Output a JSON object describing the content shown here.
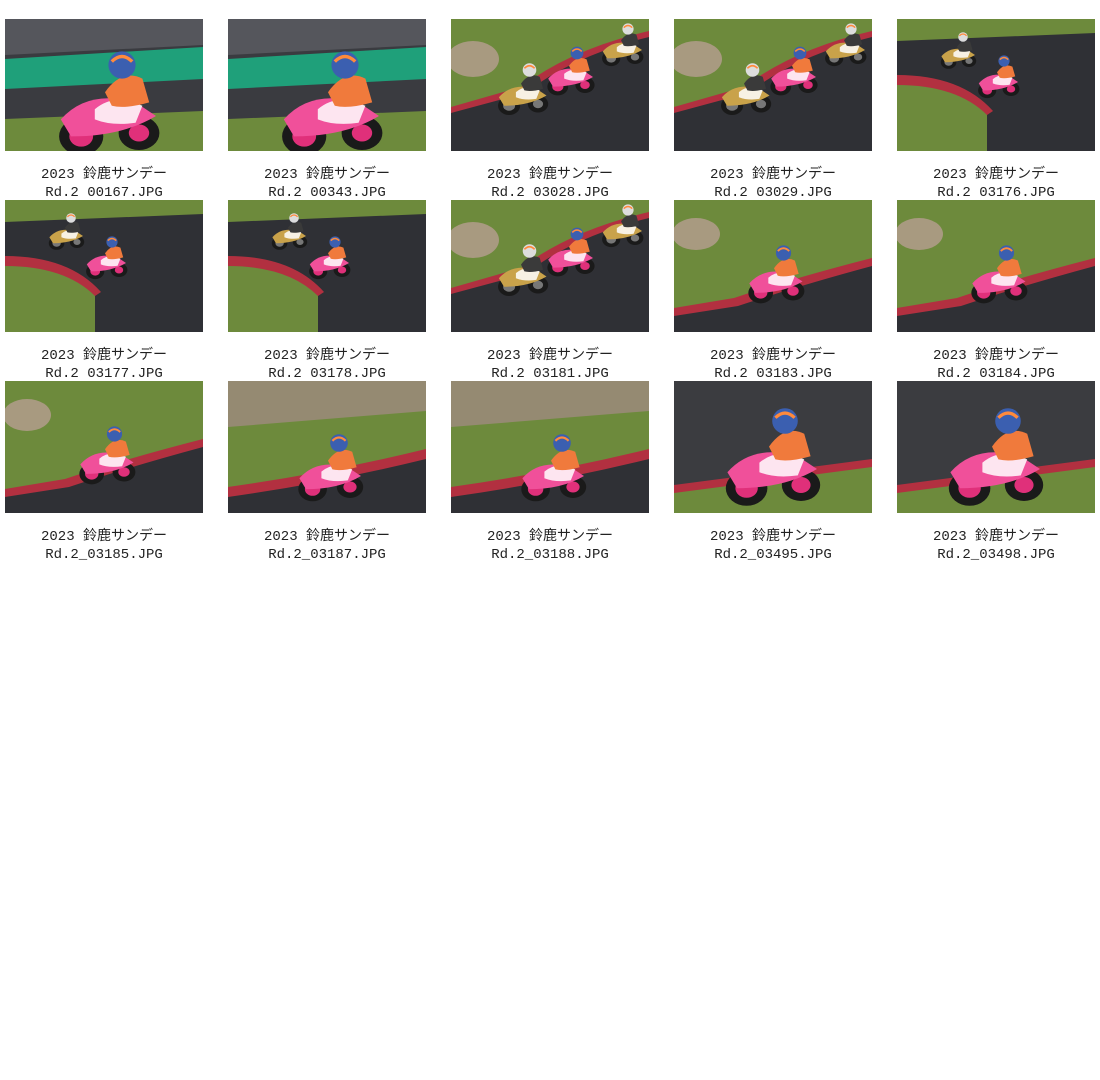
{
  "gallery": {
    "items": [
      {
        "caption_line1": "2023 鈴鹿サンデー",
        "caption_line2": "Rd.2 00167.JPG",
        "scene": "closeup-green"
      },
      {
        "caption_line1": "2023 鈴鹿サンデー",
        "caption_line2": "Rd.2 00343.JPG",
        "scene": "closeup-green"
      },
      {
        "caption_line1": "2023 鈴鹿サンデー",
        "caption_line2": "Rd.2 03028.JPG",
        "scene": "pack-grass"
      },
      {
        "caption_line1": "2023 鈴鹿サンデー",
        "caption_line2": "Rd.2 03029.JPG",
        "scene": "pack-grass"
      },
      {
        "caption_line1": "2023 鈴鹿サンデー",
        "caption_line2": "Rd.2 03176.JPG",
        "scene": "pack-curve"
      },
      {
        "caption_line1": "2023 鈴鹿サンデー",
        "caption_line2": "Rd.2 03177.JPG",
        "scene": "pack-curve"
      },
      {
        "caption_line1": "2023 鈴鹿サンデー",
        "caption_line2": "Rd.2 03178.JPG",
        "scene": "pack-curve"
      },
      {
        "caption_line1": "2023 鈴鹿サンデー",
        "caption_line2": "Rd.2 03181.JPG",
        "scene": "pack-grass"
      },
      {
        "caption_line1": "2023 鈴鹿サンデー",
        "caption_line2": "Rd.2 03183.JPG",
        "scene": "solo-grass"
      },
      {
        "caption_line1": "2023 鈴鹿サンデー",
        "caption_line2": "Rd.2 03184.JPG",
        "scene": "solo-grass"
      },
      {
        "caption_line1": "2023 鈴鹿サンデー",
        "caption_line2": "Rd.2_03185.JPG",
        "scene": "solo-grass"
      },
      {
        "caption_line1": "2023 鈴鹿サンデー",
        "caption_line2": "Rd.2_03187.JPG",
        "scene": "solo-kerb"
      },
      {
        "caption_line1": "2023 鈴鹿サンデー",
        "caption_line2": "Rd.2_03188.JPG",
        "scene": "solo-kerb"
      },
      {
        "caption_line1": "2023 鈴鹿サンデー",
        "caption_line2": "Rd.2_03495.JPG",
        "scene": "closeup-asphalt"
      },
      {
        "caption_line1": "2023 鈴鹿サンデー",
        "caption_line2": "Rd.2_03498.JPG",
        "scene": "closeup-asphalt"
      }
    ]
  },
  "colors": {
    "background": "#ffffff",
    "caption_text": "#222222",
    "asphalt": "#2f3035",
    "grass": "#6d8a3c",
    "green_runoff": "#1fa07a",
    "bike_pink": "#f0509a",
    "kerb_red": "#b23040"
  },
  "icons": {
    "thumbnail": "photo-thumbnail-icon"
  }
}
